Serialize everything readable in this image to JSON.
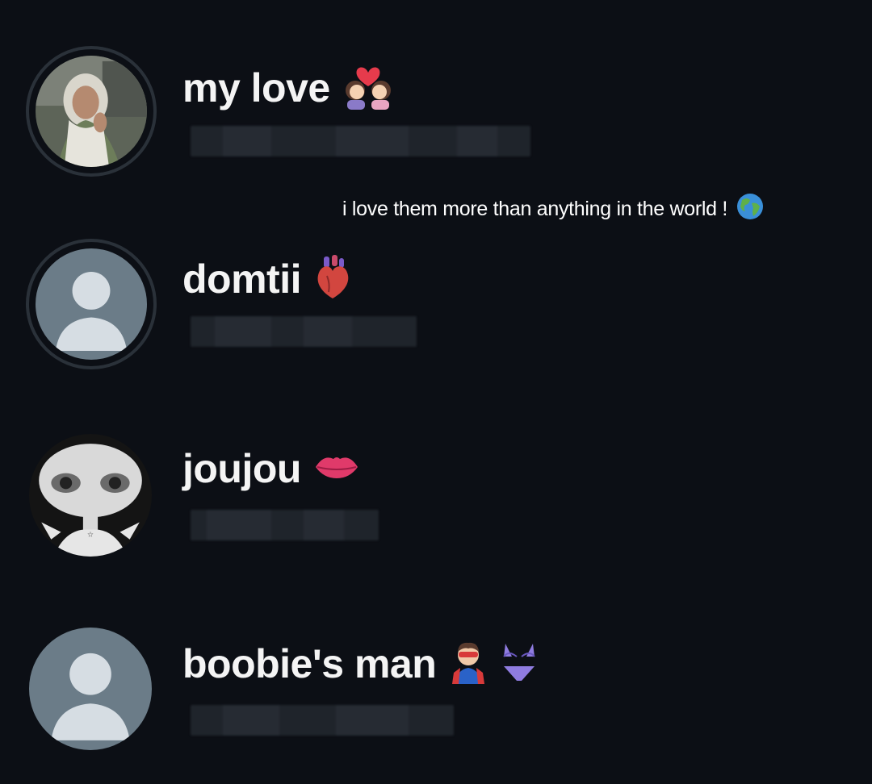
{
  "caption": {
    "text": "i love them more than anything in the world !",
    "emoji": "globe-icon"
  },
  "contacts": [
    {
      "name": "my love",
      "emojis": [
        "kiss-couple-icon"
      ],
      "avatar": "photo"
    },
    {
      "name": "domtii",
      "emojis": [
        "anatomical-heart-icon"
      ],
      "avatar": "default"
    },
    {
      "name": "joujou",
      "emojis": [
        "kiss-mark-icon"
      ],
      "avatar": "cartoon"
    },
    {
      "name": "boobie's man",
      "emojis": [
        "superhero-icon",
        "bikini-icon"
      ],
      "avatar": "default"
    }
  ],
  "colors": {
    "background": "#0c0f15",
    "default_avatar_bg": "#6b7c88",
    "default_avatar_fg": "#d6dde3",
    "ring": "#2a3139"
  }
}
